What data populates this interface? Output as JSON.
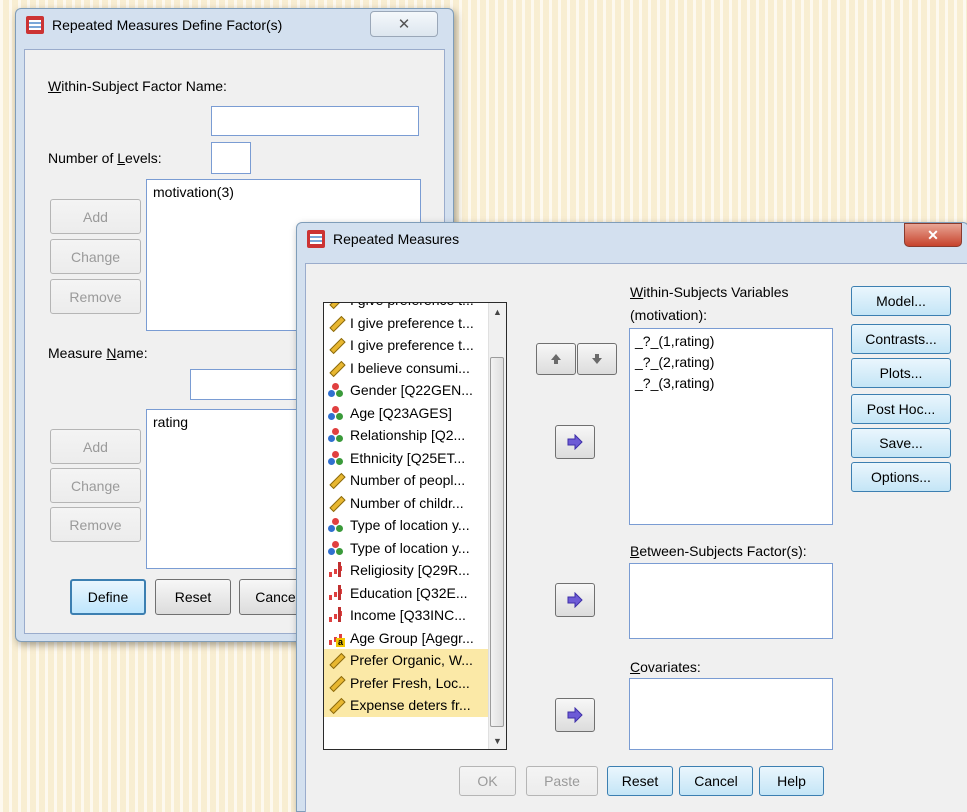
{
  "define_dialog": {
    "title": "Repeated Measures Define Factor(s)",
    "within_factor_label": "Within-Subject Factor Name:",
    "within_factor_value": "",
    "levels_label": "Number of Levels:",
    "levels_value": "",
    "factor_buttons": {
      "add": "Add",
      "change": "Change",
      "remove": "Remove"
    },
    "factor_list": [
      "motivation(3)"
    ],
    "measure_label": "Measure Name:",
    "measure_value": "",
    "measure_buttons": {
      "add": "Add",
      "change": "Change",
      "remove": "Remove"
    },
    "measure_list": [
      "rating"
    ],
    "footer": {
      "define": "Define",
      "reset": "Reset",
      "cancel": "Cancel"
    }
  },
  "rm_dialog": {
    "title": "Repeated Measures",
    "variables": [
      {
        "label": "I give preference t...",
        "type": "scale",
        "partial": true
      },
      {
        "label": "I give preference t...",
        "type": "scale"
      },
      {
        "label": "I give preference t...",
        "type": "scale"
      },
      {
        "label": "I believe consumi...",
        "type": "scale"
      },
      {
        "label": "Gender [Q22GEN...",
        "type": "nominal"
      },
      {
        "label": "Age [Q23AGES]",
        "type": "nominal"
      },
      {
        "label": "Relationship [Q2...",
        "type": "nominal"
      },
      {
        "label": "Ethnicity [Q25ET...",
        "type": "nominal"
      },
      {
        "label": "Number of peopl...",
        "type": "scale"
      },
      {
        "label": "Number of childr...",
        "type": "scale"
      },
      {
        "label": "Type of location y...",
        "type": "nominal"
      },
      {
        "label": "Type of location y...",
        "type": "nominal"
      },
      {
        "label": "Religiosity [Q29R...",
        "type": "ordinal"
      },
      {
        "label": "Education [Q32E...",
        "type": "ordinal"
      },
      {
        "label": "Income [Q33INC...",
        "type": "ordinal"
      },
      {
        "label": "Age Group [Agegr...",
        "type": "ordinal-a"
      },
      {
        "label": "Prefer Organic, W...",
        "type": "scale",
        "highlight": true
      },
      {
        "label": "Prefer Fresh, Loc...",
        "type": "scale",
        "highlight": true
      },
      {
        "label": "Expense deters fr...",
        "type": "scale",
        "highlight": true
      }
    ],
    "within_label_line1": "Within-Subjects Variables",
    "within_label_line2": "(motivation):",
    "within_items": [
      "_?_(1,rating)",
      "_?_(2,rating)",
      "_?_(3,rating)"
    ],
    "between_label": "Between-Subjects Factor(s):",
    "covariates_label": "Covariates:",
    "side_buttons": {
      "model": "Model...",
      "contrasts": "Contrasts...",
      "plots": "Plots...",
      "post_hoc": "Post Hoc...",
      "save": "Save...",
      "options": "Options..."
    },
    "footer": {
      "ok": "OK",
      "paste": "Paste",
      "reset": "Reset",
      "cancel": "Cancel",
      "help": "Help"
    }
  }
}
